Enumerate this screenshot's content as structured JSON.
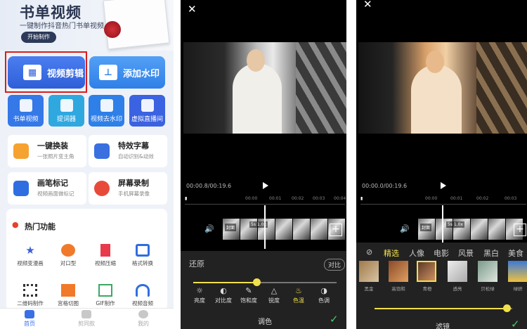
{
  "home": {
    "banner": {
      "title": "书单视频",
      "subtitle": "一键制作抖音热门书单视频",
      "button": "开始制作"
    },
    "primary": [
      {
        "label": "视频剪辑",
        "icon": "clapperboard-icon",
        "color": "#3b6fe6"
      },
      {
        "label": "添加水印",
        "icon": "stamp-icon",
        "color": "#3d8cf0"
      }
    ],
    "squares": [
      {
        "label": "书单视频",
        "icon": "book-icon"
      },
      {
        "label": "提词器",
        "icon": "prompter-icon"
      },
      {
        "label": "视频去水印",
        "icon": "camera-icon"
      },
      {
        "label": "虚拟直播间",
        "icon": "live-icon"
      }
    ],
    "cards": [
      {
        "title": "一键换装",
        "sub": "一张照片变主角",
        "icon": "shirt-icon",
        "color": "#f6a230"
      },
      {
        "title": "特效字幕",
        "sub": "自动识别&动效",
        "icon": "magic-wand-icon",
        "color": "#3a6fe0"
      },
      {
        "title": "画笔标记",
        "sub": "视频画面做标记",
        "icon": "brush-icon",
        "color": "#2f6ee0"
      },
      {
        "title": "屏幕录制",
        "sub": "手机屏幕录像",
        "icon": "film-reel-icon",
        "color": "#e84a3a"
      }
    ],
    "hot": {
      "title": "热门功能",
      "items": [
        {
          "label": "视频变漫画",
          "icon": "star-icon",
          "color": "#3a5fd8"
        },
        {
          "label": "对口型",
          "icon": "lips-icon",
          "color": "#f07a2a"
        },
        {
          "label": "视频压缩",
          "icon": "compress-icon",
          "color": "#e83a4a"
        },
        {
          "label": "格式转换",
          "icon": "convert-icon",
          "color": "#2f6ee0"
        },
        {
          "label": "二维码制作",
          "icon": "qr-icon",
          "color": "#333333"
        },
        {
          "label": "宫格切图",
          "icon": "grid-icon",
          "color": "#f07a2a"
        },
        {
          "label": "GIF制作",
          "icon": "gif-icon",
          "color": "#3aa864"
        },
        {
          "label": "视频音频",
          "icon": "headphones-icon",
          "color": "#2f6ee0"
        }
      ]
    },
    "tabs": [
      {
        "label": "首页",
        "icon": "home-icon"
      },
      {
        "label": "剪同款",
        "icon": "video-icon"
      },
      {
        "label": "我的",
        "icon": "user-icon"
      }
    ]
  },
  "editor1": {
    "close": "✕",
    "time": "00:00.8/00:19.6",
    "ruler": [
      "00:00",
      "00:01",
      "00:02",
      "00:03",
      "00:04"
    ],
    "clip_labels": [
      "封面",
      "5s 1.0x"
    ],
    "reset": "还原",
    "compare": "对比",
    "slider_position": 0.44,
    "tools": [
      {
        "label": "亮度",
        "icon": "sun-icon"
      },
      {
        "label": "对比度",
        "icon": "contrast-icon"
      },
      {
        "label": "饱和度",
        "icon": "dropper-icon"
      },
      {
        "label": "锐度",
        "icon": "triangle-icon"
      },
      {
        "label": "色温",
        "icon": "thermometer-icon"
      },
      {
        "label": "色调",
        "icon": "tone-icon"
      }
    ],
    "active_tool": "色温",
    "title": "调色",
    "confirm": "✓"
  },
  "editor2": {
    "close": "✕",
    "time": "00:00.0/00:19.6",
    "ruler": [
      "00:00",
      "00:01",
      "00:02",
      "00:03"
    ],
    "clip_labels": [
      "封面",
      "5s 1.0x"
    ],
    "categories": [
      "精选",
      "人像",
      "电影",
      "风景",
      "黑白",
      "美食"
    ],
    "active_category": "精选",
    "filters": [
      "黑金",
      "高饱和",
      "青橙",
      "透亮",
      "贝松绿",
      "绿妍"
    ],
    "active_filter": "青橙",
    "slider_position": 0.96,
    "title": "滤镜",
    "confirm": "✓"
  }
}
